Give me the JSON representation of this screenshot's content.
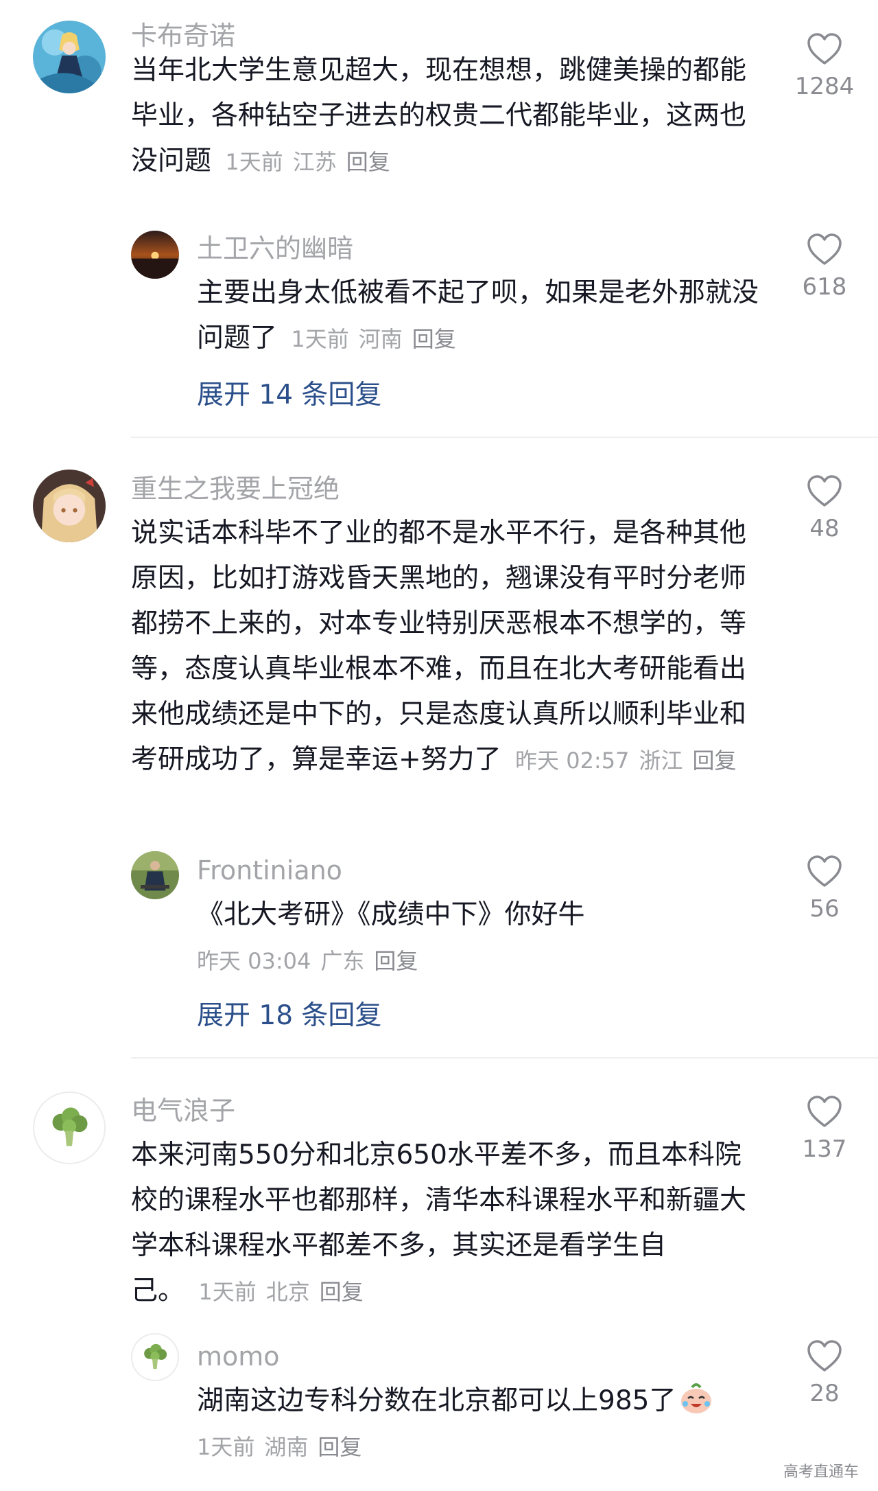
{
  "comments": [
    {
      "user": "卡布奇诺",
      "text": "当年北大学生意见超大，现在想想，跳健美操的都能毕业，各种钻空子进去的权贵二代都能毕业，这两也没问题",
      "time": "1天前",
      "location": "江苏",
      "reply_label": "回复",
      "likes": "1284",
      "avatar_icon": "anime-girl-avatar",
      "reply": {
        "user": "土卫六的幽暗",
        "text": "主要出身太低被看不起了呗，如果是老外那就没问题了",
        "time": "1天前",
        "location": "河南",
        "reply_label": "回复",
        "likes": "618",
        "avatar_icon": "sunset-avatar"
      },
      "expand_label": "展开 14 条回复"
    },
    {
      "user": "重生之我要上冠绝",
      "text": "说实话本科毕不了业的都不是水平不行，是各种其他原因，比如打游戏昏天黑地的，翘课没有平时分老师都捞不上来的，对本专业特别厌恶根本不想学的，等等，态度认真毕业根本不难，而且在北大考研能看出来他成绩还是中下的，只是态度认真所以顺利毕业和考研成功了，算是幸运+努力了",
      "time": "昨天 02:57",
      "location": "浙江",
      "reply_label": "回复",
      "likes": "48",
      "avatar_icon": "blonde-girl-avatar",
      "reply": {
        "user": "Frontiniano",
        "text": "《北大考研》《成绩中下》你好牛",
        "time": "昨天 03:04",
        "location": "广东",
        "reply_label": "回复",
        "likes": "56",
        "avatar_icon": "person-in-park-avatar"
      },
      "expand_label": "展开 18 条回复"
    },
    {
      "user": "电气浪子",
      "text": "本来河南550分和北京650水平差不多，而且本科院校的课程水平也都那样，清华本科课程水平和新疆大学本科课程水平都差不多，其实还是看学生自己。",
      "time": "1天前",
      "location": "北京",
      "reply_label": "回复",
      "likes": "137",
      "avatar_icon": "broccoli-avatar",
      "reply": {
        "user": "momo",
        "text": "湖南这边专科分数在北京都可以上985了",
        "time": "1天前",
        "location": "湖南",
        "reply_label": "回复",
        "likes": "28",
        "avatar_icon": "broccoli-avatar",
        "emoji": "crying-laughing-emoji"
      }
    }
  ],
  "watermark": "高考直通车",
  "colors": {
    "text": "#161823",
    "meta": "#a3a4a8",
    "expand_link": "#2b4f8a",
    "heart_outline": "#8a8b91",
    "divider": "#efeff2"
  }
}
